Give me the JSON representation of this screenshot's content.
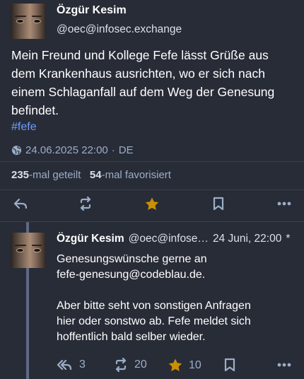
{
  "main_post": {
    "author_name": "Özgür Kesim",
    "author_handle": "@oec@infosec.exchange",
    "content": "Mein Freund und Kollege Fefe lässt Grüße aus dem Krankenhaus ausrichten, wo er sich nach einem Schlaganfall auf dem Weg der Genesung befindet.",
    "hashtag": "#fefe",
    "timestamp": "24.06.2025 22:00",
    "separator": "·",
    "language": "DE",
    "boosts_count": "235",
    "boosts_label": "-mal geteilt",
    "favourites_count": "54",
    "favourites_label": "-mal favorisiert"
  },
  "reply": {
    "author_name": "Özgür Kesim",
    "author_handle": "@oec@infose…",
    "time": "24 Juni, 22:00",
    "edited_marker": "*",
    "paragraph1_line1": "Genesungswünsche gerne an",
    "paragraph1_line2": "fefe-genesung@codeblau.de.",
    "paragraph2": "Aber bitte seht von sonstigen Anfragen hier oder sonstwo ab. Fefe meldet sich hoffentlich bald selber wieder.",
    "reply_count": "3",
    "boost_count": "20",
    "favourite_count": "10"
  },
  "icons": {
    "reply": "reply-icon",
    "reply_all": "reply-all-icon",
    "boost": "boost-icon",
    "favourite": "star-icon",
    "bookmark": "bookmark-icon",
    "more": "more-icon",
    "visibility": "globe-icon"
  },
  "colors": {
    "background": "#282c37",
    "text": "#ffffff",
    "secondary": "#9baec8",
    "hashtag": "#6d9eff",
    "star_active": "#ca8f04",
    "thread_line": "#606984"
  }
}
